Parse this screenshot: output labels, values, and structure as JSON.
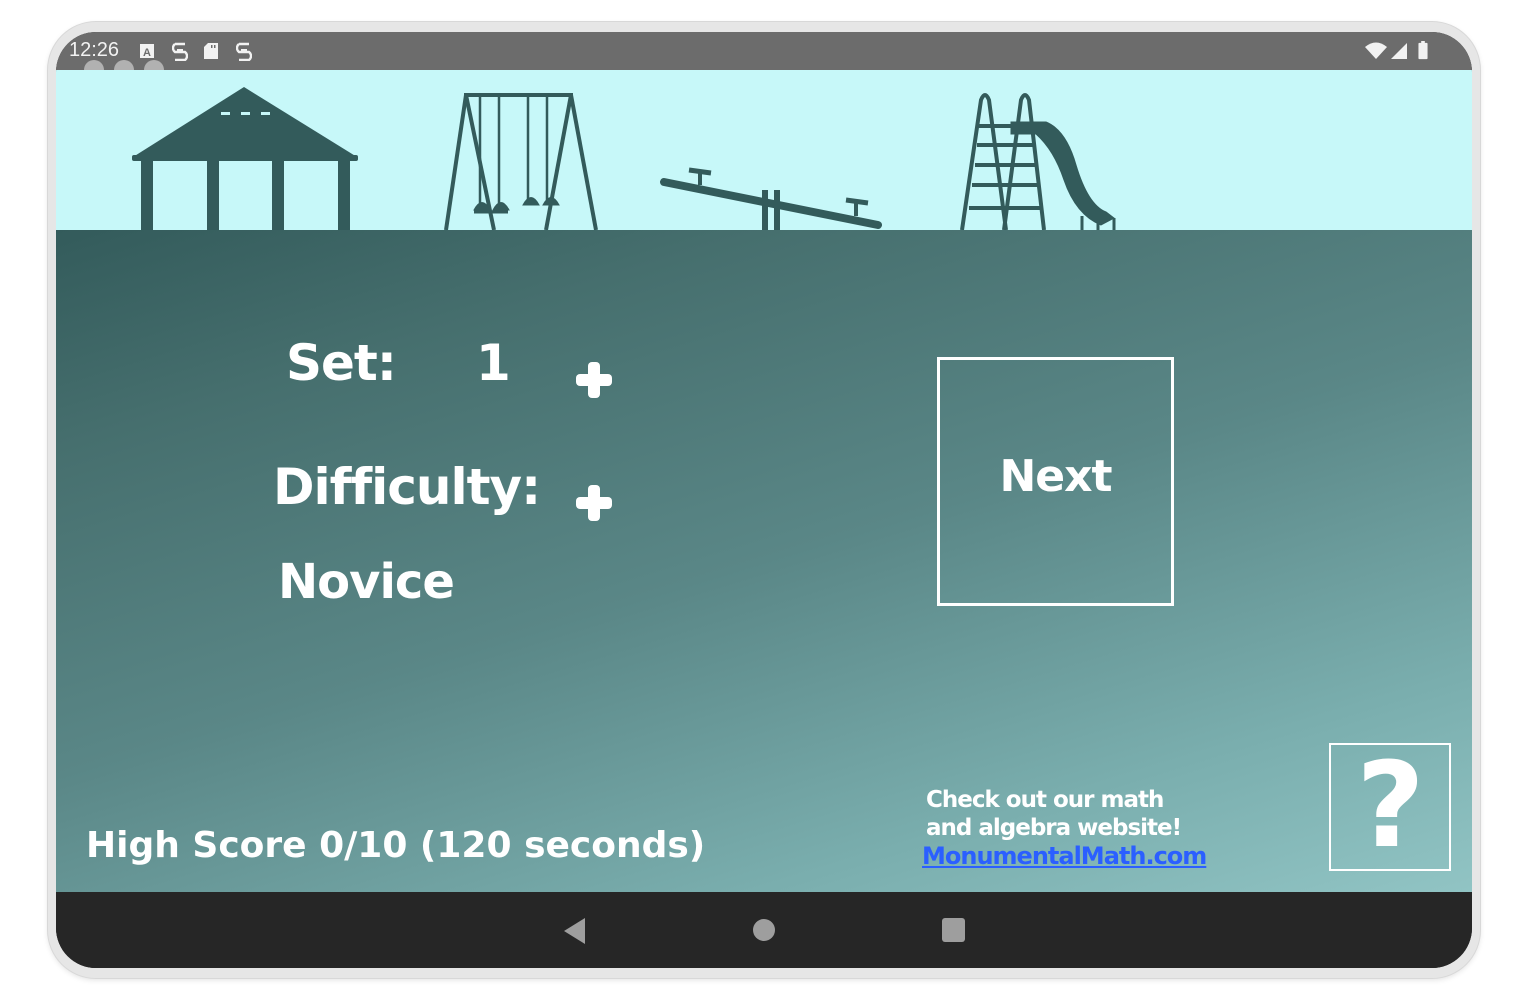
{
  "status_bar": {
    "time": "12:26",
    "left_icons": [
      "a-notification-icon",
      "sim-icon",
      "sd-card-icon",
      "sim-icon"
    ],
    "right_icons": [
      "wifi-icon",
      "cell-signal-icon",
      "battery-icon"
    ]
  },
  "scene": {
    "sky_color": "#c7f8f9",
    "silhouette_color": "#335b5b",
    "items": [
      "gazebo",
      "swing-set",
      "seesaw",
      "slide"
    ]
  },
  "settings": {
    "set_label": "Set:",
    "set_value": "1",
    "difficulty_label": "Difficulty:",
    "difficulty_value": "Novice",
    "increment_symbol": "+"
  },
  "next_button": {
    "label": "Next"
  },
  "high_score": {
    "text": "High Score 0/10 (120 seconds)"
  },
  "promo": {
    "line1": "Check out our math",
    "line2": "and algebra website!",
    "link_text": "MonumentalMath.com",
    "link_color": "#2b5fff"
  },
  "help_button": {
    "label": "?"
  },
  "nav_bar": {
    "buttons": [
      "back",
      "home",
      "recents"
    ]
  }
}
